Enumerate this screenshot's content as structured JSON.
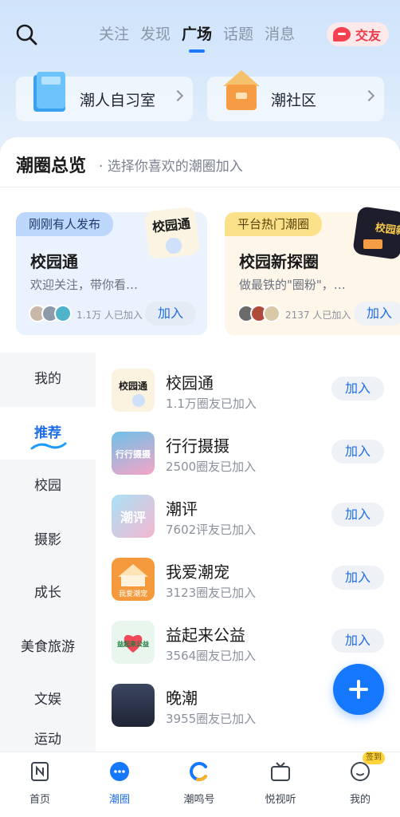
{
  "header": {
    "tabs": [
      {
        "label": "关注"
      },
      {
        "label": "发现"
      },
      {
        "label": "广场"
      },
      {
        "label": "话题"
      },
      {
        "label": "消息"
      }
    ],
    "active_tab": "广场",
    "friend_button": "交友"
  },
  "entries": [
    {
      "label": "潮人自习室"
    },
    {
      "label": "潮社区"
    }
  ],
  "overview": {
    "title": "潮圈总览",
    "subtitle": "· 选择你喜欢的潮圈加入"
  },
  "featured": [
    {
      "badge": "刚刚有人发布",
      "title": "校园通",
      "desc": "欢迎关注，带你看…",
      "count": "1.1万 人已加入",
      "join": "加入",
      "image_text": "校园通"
    },
    {
      "badge": "平台热门潮圈",
      "title": "校园新探圈",
      "desc": "做最铁的\"圈粉\"，…",
      "count": "2137 人已加入",
      "join": "加入",
      "image_text": "校园新"
    }
  ],
  "categories": [
    {
      "label": "我的"
    },
    {
      "label": "推荐"
    },
    {
      "label": "校园"
    },
    {
      "label": "摄影"
    },
    {
      "label": "成长"
    },
    {
      "label": "美食旅游"
    },
    {
      "label": "文娱"
    },
    {
      "label": "运动"
    }
  ],
  "active_category": "推荐",
  "circles": [
    {
      "name": "校园通",
      "meta": "1.1万圈友已加入",
      "join": "加入",
      "thumb_text": "校园通",
      "color": "#fbf3df"
    },
    {
      "name": "行行摄摄",
      "meta": "2500圈友已加入",
      "join": "加入",
      "thumb_text": "行行摄摄",
      "color": "#7cc7e8"
    },
    {
      "name": "潮评",
      "meta": "7602评友已加入",
      "join": "加入",
      "thumb_text": "潮评",
      "color": "#8fd1f0"
    },
    {
      "name": "我爱潮宠",
      "meta": "3123圈友已加入",
      "join": "加入",
      "thumb_text": "我爱潮宠",
      "color": "#f59a3c"
    },
    {
      "name": "益起来公益",
      "meta": "3564圈友已加入",
      "join": "加入",
      "thumb_text": "益起来公益",
      "color": "#e8f6ee"
    },
    {
      "name": "晚潮",
      "meta": "3955圈友已加入",
      "join": "",
      "thumb_text": "",
      "color": "#2d3447"
    }
  ],
  "bottom_nav": [
    {
      "label": "首页"
    },
    {
      "label": "潮圈"
    },
    {
      "label": "潮鸣号"
    },
    {
      "label": "悦视听"
    },
    {
      "label": "我的"
    }
  ],
  "signin_badge": "签到",
  "colors": {
    "accent": "#1e6de6",
    "fab": "#1677ff",
    "friend": "#f03a4a"
  }
}
